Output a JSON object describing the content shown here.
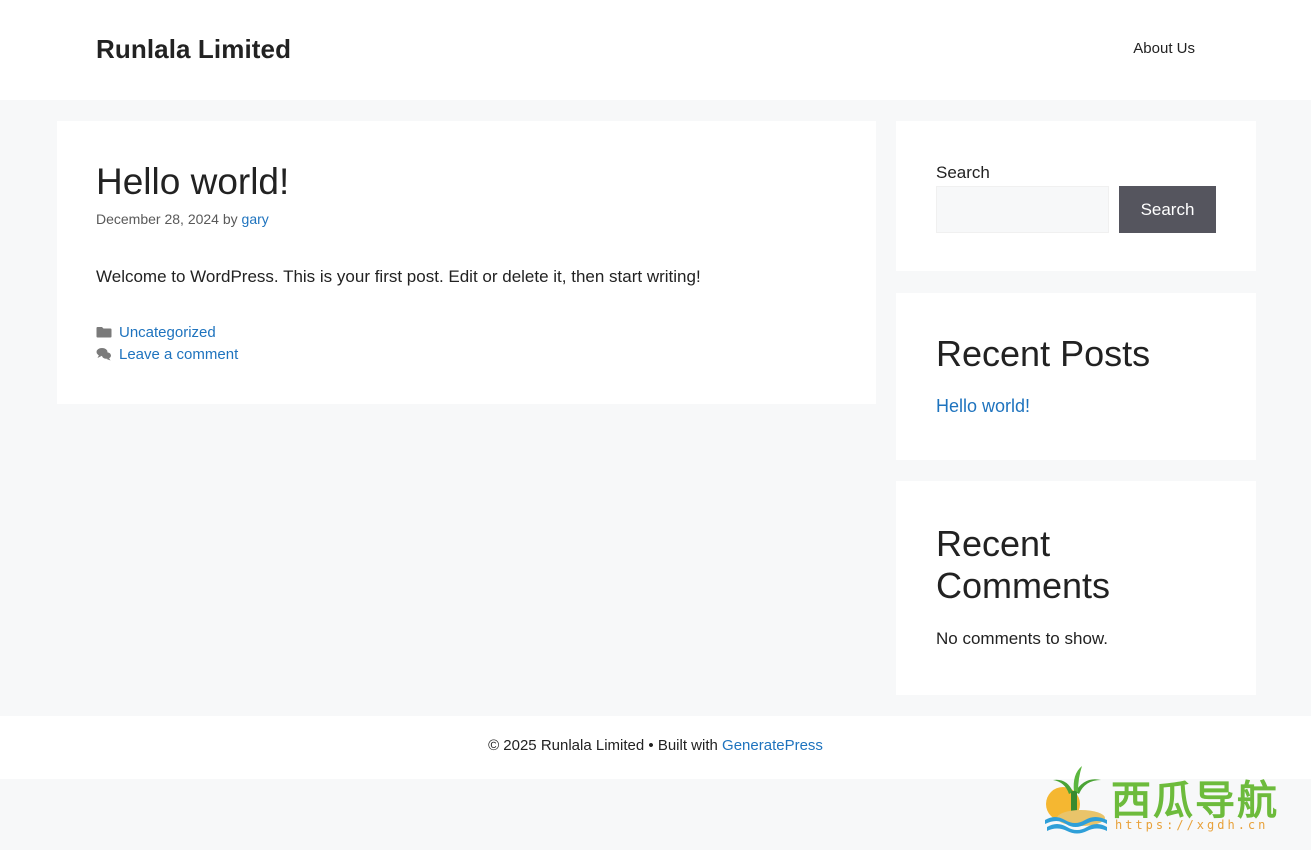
{
  "header": {
    "site_title": "Runlala Limited",
    "nav": [
      {
        "label": "About Us"
      }
    ]
  },
  "post": {
    "title": "Hello world!",
    "date": "December 28, 2024",
    "by": "by",
    "author": "gary",
    "body": "Welcome to WordPress. This is your first post. Edit or delete it, then start writing!",
    "category": "Uncategorized",
    "comment_link": "Leave a comment",
    "category_icon": "folder-icon",
    "comment_icon": "comments-icon"
  },
  "sidebar": {
    "search": {
      "label": "Search",
      "input_value": "",
      "button_label": "Search"
    },
    "recent_posts": {
      "title": "Recent Posts",
      "items": [
        "Hello world!"
      ]
    },
    "recent_comments": {
      "title": "Recent Comments",
      "empty_text": "No comments to show."
    }
  },
  "footer": {
    "copyright": "© 2025 Runlala Limited",
    "separator": "•",
    "built_with": "Built with",
    "theme_link": "GeneratePress"
  },
  "watermark": {
    "text": "西瓜导航",
    "url": "https://xgdh.cn"
  },
  "colors": {
    "link": "#1e73be",
    "button_bg": "#55555e",
    "page_bg": "#f7f8f9",
    "watermark_green": "#6dbb3c",
    "watermark_orange": "#e8a13a"
  }
}
